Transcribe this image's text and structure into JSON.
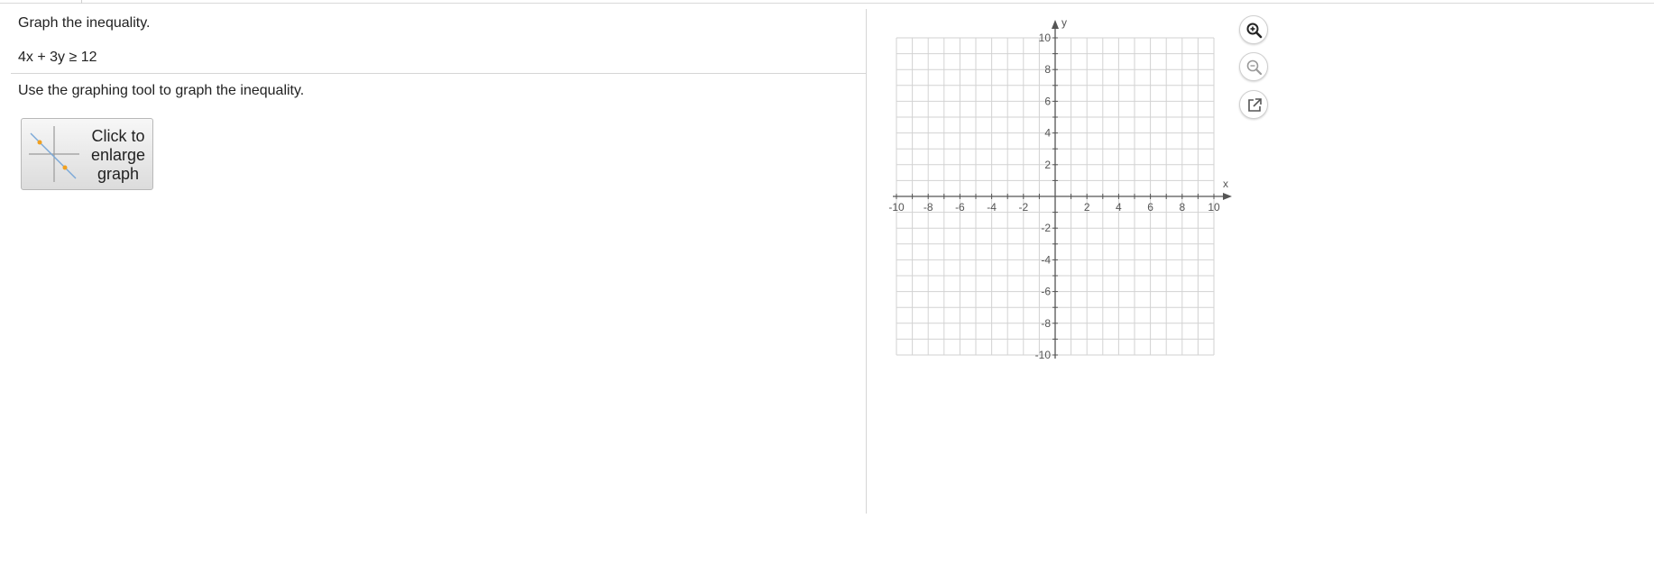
{
  "question": {
    "instruction": "Graph the inequality.",
    "equation": "4x + 3y ≥ 12",
    "tool_instruction": "Use the graphing tool to graph the inequality."
  },
  "enlarge_button": {
    "label": "Click to\nenlarge\ngraph",
    "icon": "graph-thumbnail-icon"
  },
  "graph_tools": [
    {
      "name": "zoom-in-button",
      "icon": "zoom-in-icon"
    },
    {
      "name": "zoom-out-button",
      "icon": "zoom-out-icon"
    },
    {
      "name": "open-external-button",
      "icon": "external-link-icon"
    }
  ],
  "colors": {
    "grid": "#d2d2d2",
    "axis": "#555555",
    "label": "#555555",
    "thumb_line": "#7aa8d8",
    "thumb_point": "#f0a020"
  },
  "chart_data": {
    "type": "scatter",
    "xlabel": "x",
    "ylabel": "y",
    "xlim": [
      -10,
      10
    ],
    "ylim": [
      -10,
      10
    ],
    "grid": true,
    "minor_step": 1,
    "label_step": 2,
    "x_tick_labels": [
      "-10",
      "-8",
      "-6",
      "-4",
      "-2",
      "2",
      "4",
      "6",
      "8",
      "10"
    ],
    "y_tick_labels": [
      "10",
      "8",
      "6",
      "4",
      "2",
      "-2",
      "-4",
      "-6",
      "-8",
      "-10"
    ],
    "series": []
  }
}
